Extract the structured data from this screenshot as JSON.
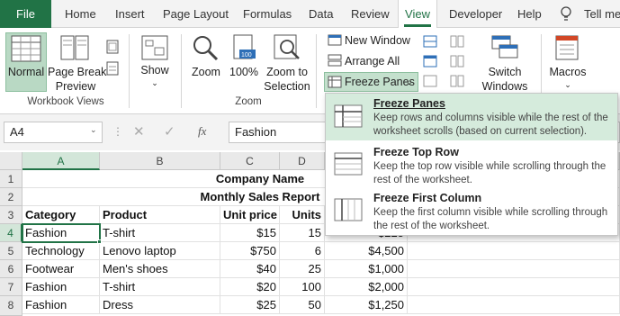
{
  "tabs": [
    "File",
    "Home",
    "Insert",
    "Page Layout",
    "Formulas",
    "Data",
    "Review",
    "View",
    "Developer",
    "Help",
    "Tell me"
  ],
  "ribbon": {
    "workbook_views": {
      "normal": "Normal",
      "page_break_1": "Page Break",
      "page_break_2": "Preview",
      "group": "Workbook Views"
    },
    "show": "Show",
    "zoom": {
      "zoom": "Zoom",
      "hundred": "100%",
      "sel_1": "Zoom to",
      "sel_2": "Selection",
      "group": "Zoom"
    },
    "window": {
      "new_window": "New Window",
      "arrange_all": "Arrange All",
      "freeze_panes": "Freeze Panes",
      "switch_1": "Switch",
      "switch_2": "Windows"
    },
    "macros": "Macros"
  },
  "formula_bar": {
    "name_box": "A4",
    "fx": "fx",
    "value": "Fashion"
  },
  "columns": [
    "A",
    "B",
    "C",
    "D"
  ],
  "rows": [
    "1",
    "2",
    "3",
    "4",
    "5",
    "6",
    "7",
    "8"
  ],
  "sheet": {
    "title": "Company Name",
    "subtitle": "Monthly Sales Report",
    "headers": [
      "Category",
      "Product",
      "Unit price",
      "Units"
    ],
    "data": [
      [
        "Fashion",
        "T-shirt",
        "$15",
        "15",
        "$225"
      ],
      [
        "Technology",
        "Lenovo laptop",
        "$750",
        "6",
        "$4,500"
      ],
      [
        "Footwear",
        "Men's shoes",
        "$40",
        "25",
        "$1,000"
      ],
      [
        "Fashion",
        "T-shirt",
        "$20",
        "100",
        "$2,000"
      ],
      [
        "Fashion",
        "Dress",
        "$25",
        "50",
        "$1,250"
      ]
    ]
  },
  "dropdown": [
    {
      "title": "Freeze Panes",
      "desc": "Keep rows and columns visible while the rest of the worksheet scrolls (based on current selection)."
    },
    {
      "title": "Freeze Top Row",
      "desc": "Keep the top row visible while scrolling through the rest of the worksheet."
    },
    {
      "title": "Freeze First Column",
      "desc": "Keep the first column visible while scrolling through the rest of the worksheet."
    }
  ],
  "colors": {
    "excel_green": "#217346",
    "highlight": "#d5ebdc",
    "selected_btn": "#b9d9c4"
  }
}
